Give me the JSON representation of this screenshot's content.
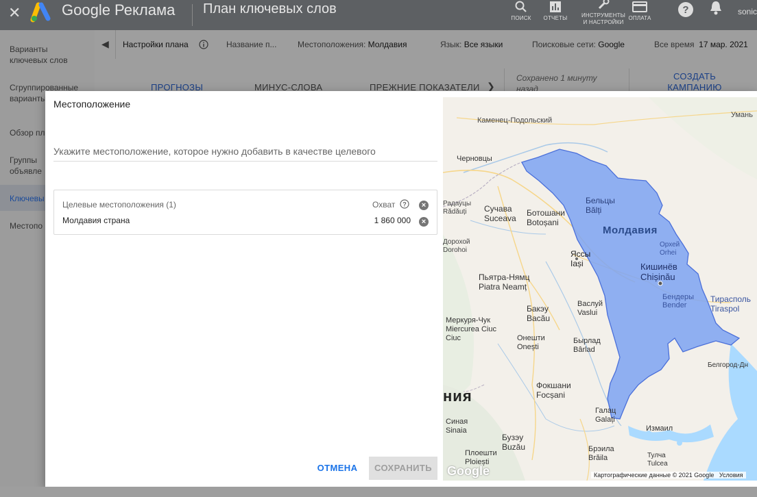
{
  "topbar": {
    "close_icon": "close-icon",
    "brand": "Google Реклама",
    "page_title": "План ключевых слов",
    "tools": [
      {
        "label": "ПОИСК",
        "icon": "search-icon"
      },
      {
        "label": "ОТЧЕТЫ",
        "icon": "reports-icon"
      },
      {
        "label": "ИНСТРУМЕНТЫ И НАСТРОЙКИ",
        "icon": "wrench-icon"
      },
      {
        "label": "ОПЛАТА",
        "icon": "billing-icon"
      }
    ],
    "user": "sonic"
  },
  "sidebar": {
    "items": [
      {
        "label": "Варианты ключевых слов"
      },
      {
        "label": "Сгруппированные варианты"
      },
      {
        "label": "Обзор пл"
      },
      {
        "label": "Группы объявле"
      },
      {
        "label": "Ключевы"
      },
      {
        "label": "Местопо"
      }
    ]
  },
  "planbar": {
    "settings": "Настройки плана",
    "name": "Название п...",
    "location_label": "Местоположения:",
    "location_value": "Молдавия",
    "language_label": "Язык:",
    "language_value": "Все языки",
    "networks_label": "Поисковые сети:",
    "networks_value": "Google",
    "time_label": "Все время",
    "time_value": "17 мар. 2021"
  },
  "tabs": {
    "forecasts": "ПРОГНОЗЫ",
    "negative": "МИНУС-СЛОВА",
    "historical": "ПРЕЖНИЕ ПОКАЗАТЕЛИ",
    "saved_line1": "Сохранено 1 минуту",
    "saved_line2": "назад",
    "create_line1": "СОЗДАТЬ",
    "create_line2": "КАМПАНИЮ"
  },
  "dialog": {
    "title": "Местоположение",
    "input_placeholder": "Укажите местоположение, которое нужно добавить в качестве целевого",
    "targets_header": "Целевые местоположения (1)",
    "reach_header": "Охват",
    "target_location": "Молдавия страна",
    "target_reach": "1 860 000",
    "cancel": "ОТМЕНА",
    "save": "СОХРАНИТЬ"
  },
  "map": {
    "attribution": "Картографические данные © 2021 Google",
    "terms": "Условия",
    "google_logo": "Google",
    "country_label": "Молдавия",
    "region_fill": "#7da3f2",
    "labels": [
      "Каменец-Подольский",
      "Умань",
      "Черновцы",
      "Радауцы",
      "Rădăuți",
      "Сучава",
      "Suceava",
      "Ботошани",
      "Botoșani",
      "Бельцы",
      "Bălți",
      "Дорохой",
      "Dorohoi",
      "Яссы",
      "Iași",
      "Орхей",
      "Orhei",
      "Кишинёв",
      "Chișinău",
      "Пьятра-Нямц",
      "Piatra Neamț",
      "Бендеры",
      "Bender",
      "Тирасполь",
      "Tiraspol",
      "Бакэу",
      "Bacău",
      "Васлуй",
      "Vaslui",
      "Меркуря-Чук",
      "Miercurea Ciuc",
      "Онешти",
      "Onești",
      "Бырлад",
      "Bârlad",
      "Белгород-Дн",
      "ния",
      "Фокшани",
      "Focșani",
      "Галац",
      "Galați",
      "Синая",
      "Sinaia",
      "Измаил",
      "Бузэу",
      "Buzău",
      "Брэила",
      "Brăila",
      "Тулча",
      "Tulcea",
      "Плоешти",
      "Ploiești"
    ]
  }
}
